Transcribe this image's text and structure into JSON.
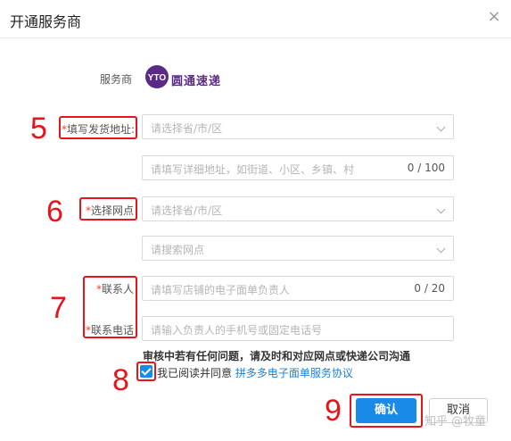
{
  "dialog": {
    "title": "开通服务商",
    "close_glyph": "×"
  },
  "provider": {
    "label": "服务商",
    "logo_text": "圆通速递",
    "logo_mark_text": "YTO"
  },
  "address": {
    "required_mark": "*",
    "label": "填写发货地址:",
    "region_placeholder": "请选择省/市/区",
    "detail_placeholder": "请填写详细地址，如街道、小区、乡镇、村",
    "detail_count": "0 / 100"
  },
  "outlet": {
    "required_mark": "*",
    "label": "选择网点",
    "region_placeholder": "请选择省/市/区",
    "search_placeholder": "请搜索网点"
  },
  "contact": {
    "required_mark": "*",
    "name_label": "联系人",
    "name_placeholder": "请填写店铺的电子面单负责人",
    "name_count": "0 / 20",
    "phone_label": "联系电话",
    "phone_placeholder": "请输入负责人的手机号或固定电话号"
  },
  "notice": "审核中若有任何问题，请及时和对应网点或快递公司沟通",
  "agreement": {
    "checked": true,
    "text": "我已阅读并同意",
    "link": "拼多多电子面单服务协议"
  },
  "buttons": {
    "confirm": "确认",
    "cancel": "取消"
  },
  "annotations": [
    "5",
    "6",
    "7",
    "8",
    "9"
  ],
  "watermark": "知乎 @牧童",
  "colors": {
    "primary": "#1a8ae8",
    "annotation_red": "#e8141b",
    "brand_purple": "#5b2a86"
  }
}
